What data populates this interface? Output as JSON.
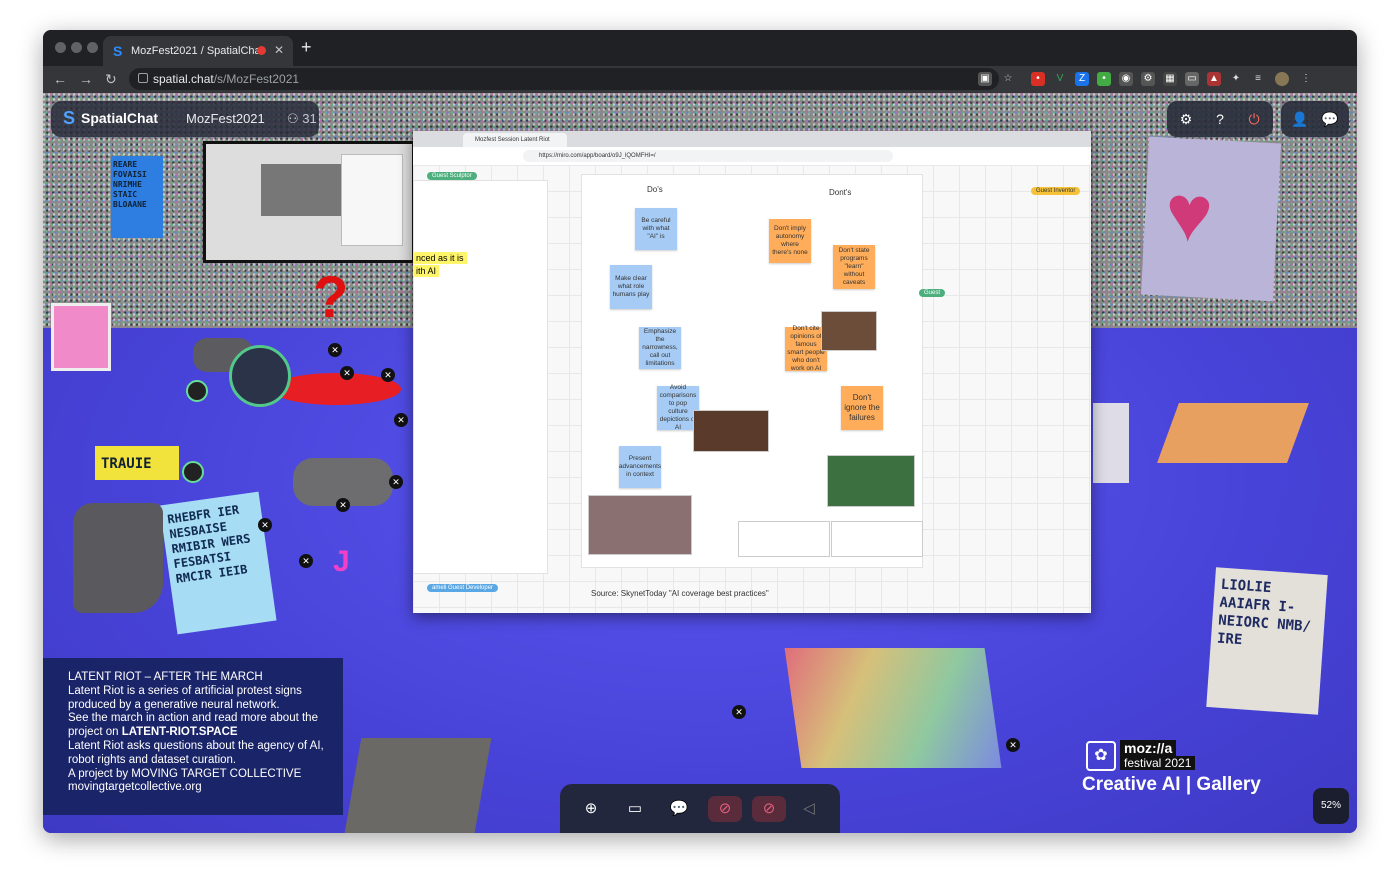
{
  "browser": {
    "tab_title": "MozFest2021 / SpatialChat",
    "url_host": "spatial.chat",
    "url_path": "/s/MozFest2021"
  },
  "spatialchat": {
    "brand": "SpatialChat",
    "room_name": "MozFest2021",
    "participant_count": "31"
  },
  "miro": {
    "tab_title": "Mozfest Session Latent Riot",
    "url": "https://miro.com/app/board/o9J_lQOMFHI=/",
    "dos_header": "Do's",
    "donts_header": "Dont's",
    "dos": [
      "Be careful with what \"AI\" is",
      "Make clear what role humans play",
      "Emphasize the narrowness, call out limitations",
      "Avoid comparisons to pop culture depictions of AI",
      "Present advancements in context"
    ],
    "donts": [
      "Don't imply autonomy where there's none",
      "Don't state programs \"learn\" without caveats",
      "Don't cite opinions of famous smart people who don't work on AI",
      "Don't ignore the failures"
    ],
    "highlight_text_1": "nced as it is",
    "highlight_text_2": "ith AI",
    "source": "Source: SkynetToday \"AI coverage best practices\"",
    "cursors": {
      "sculptor": "Guest Sculptor",
      "inventor": "Guest Inventor",
      "guest": "Guest",
      "developer": "Guest Developer",
      "developer_prefix": "ameli"
    }
  },
  "info": {
    "title": "LATENT RIOT – AFTER THE MARCH",
    "l1": "Latent Riot is a series of artificial protest signs",
    "l2": "produced by a generative neural network.",
    "l3": "See the march in action and read more about the",
    "l4a": "project on ",
    "l4b": "LATENT-RIOT.SPACE",
    "l5": "Latent Riot asks questions about the agency of AI,",
    "l6": "robot rights and dataset curation.",
    "l7": "A project by MOVING TARGET COLLECTIVE",
    "l8": "movingtargetcollective.org"
  },
  "gallery": {
    "mozilla": "moz://a",
    "festival": "festival 2021",
    "title": "Creative AI | Gallery"
  },
  "zoom": "52%",
  "signs": {
    "blue_sign": "RHEBFR IER NESBAISE RMIBIR WERS FESBATSI RMCIR IEIB",
    "board_sign": "REARE FOVAISI NRIMHE STAIC BLOAANE",
    "right_sign": "LIOLIE AAIAFR I-NEIORC NMB/ IRE",
    "yellow_sign": "TRAUIE"
  },
  "colors": {
    "accent": "#4fa3ff",
    "sticky_blue": "#a6ccf5",
    "sticky_orange": "#ffad5a",
    "info_bg": "#1a2468",
    "floor": "#4a46dd"
  }
}
